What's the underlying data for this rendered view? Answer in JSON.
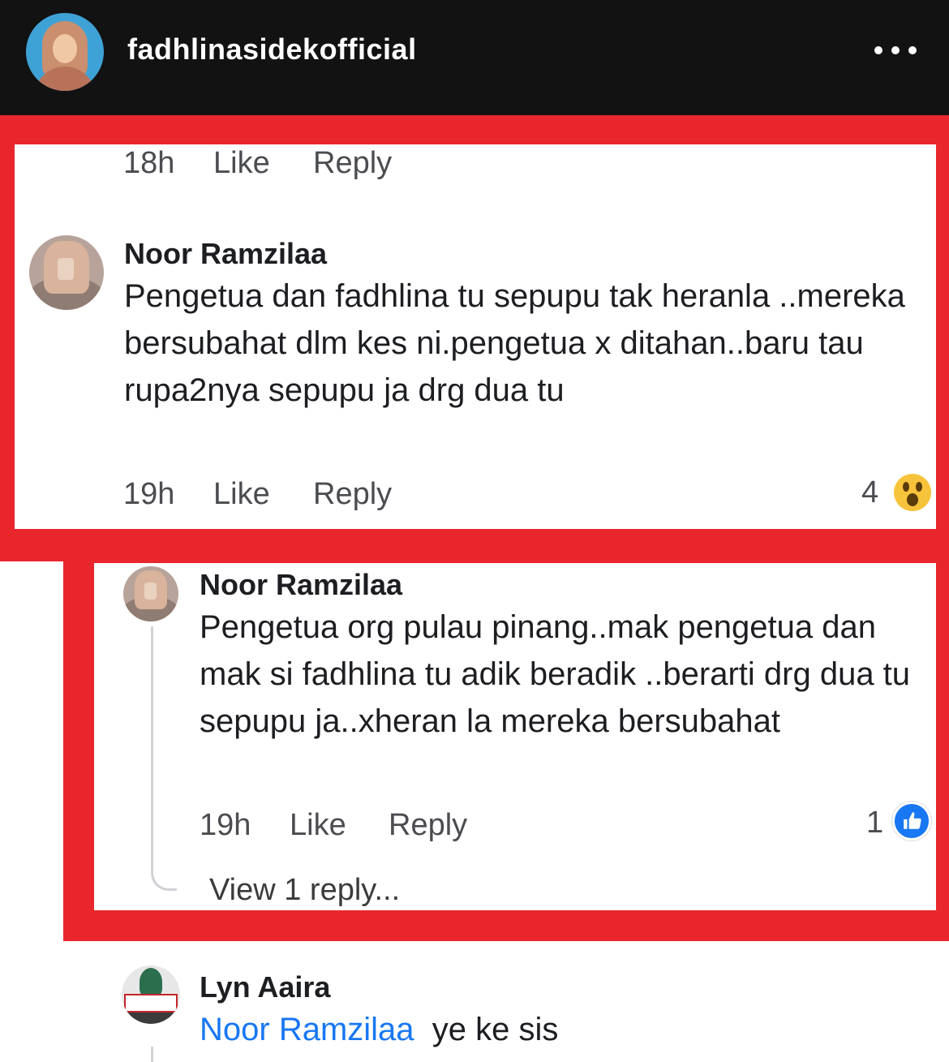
{
  "header": {
    "username": "fadhlinasidekofficial"
  },
  "comments": [
    {
      "time": "18h",
      "like": "Like",
      "reply": "Reply"
    },
    {
      "author": "Noor Ramzilaa",
      "text": "Pengetua dan fadhlina tu sepupu tak heranla ..mereka bersubahat dlm kes ni.pengetua x ditahan..baru tau rupa2nya sepupu ja drg dua tu",
      "time": "19h",
      "like": "Like",
      "reply": "Reply",
      "reaction_count": "4",
      "reaction": "wow-icon"
    },
    {
      "author": "Noor Ramzilaa",
      "text": "Pengetua org pulau pinang..mak pengetua dan mak si fadhlina tu adik beradik ..berarti drg dua tu sepupu ja..xheran la mereka bersubahat",
      "time": "19h",
      "like": "Like",
      "reply": "Reply",
      "reaction_count": "1",
      "reaction": "like-icon",
      "view_replies": "View 1 reply..."
    },
    {
      "author": "Lyn Aaira",
      "mention": "Noor Ramzilaa",
      "text": "ye ke sis"
    }
  ],
  "colors": {
    "highlight": "#e8262c",
    "header_bg": "#121212",
    "link": "#1877f2"
  }
}
